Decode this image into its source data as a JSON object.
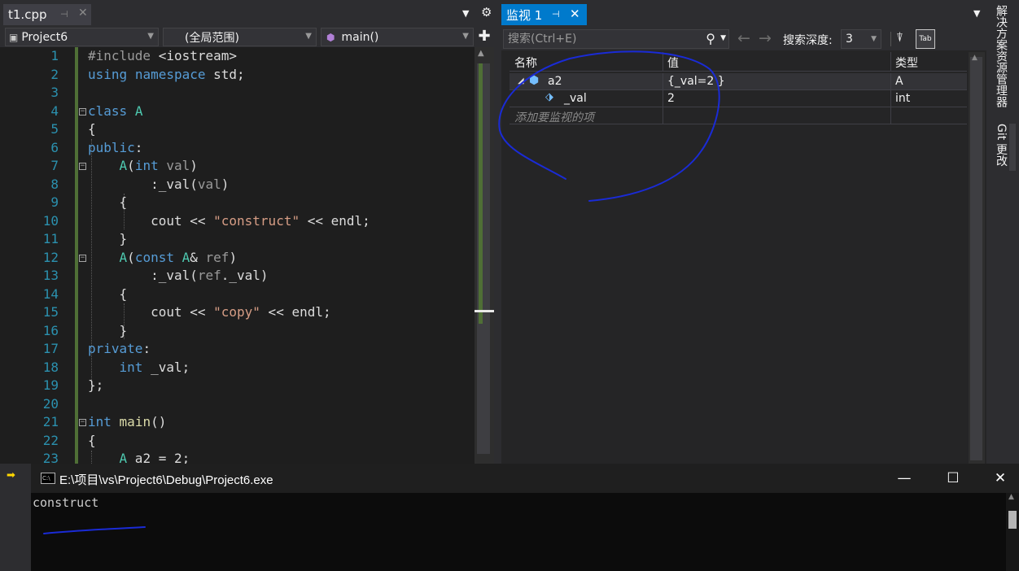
{
  "editor": {
    "tab": {
      "name": "t1.cpp",
      "pin_icon": "pin-icon",
      "close_icon": "close-icon"
    },
    "nav": {
      "project": "Project6",
      "scope": "(全局范围)",
      "member": "main()"
    },
    "code_lines": [
      {
        "n": "1",
        "text": "#include <iostream>"
      },
      {
        "n": "2",
        "text": "using namespace std;"
      },
      {
        "n": "3",
        "text": ""
      },
      {
        "n": "4",
        "text": "class A"
      },
      {
        "n": "5",
        "text": "{"
      },
      {
        "n": "6",
        "text": "public:"
      },
      {
        "n": "7",
        "text": "    A(int val)"
      },
      {
        "n": "8",
        "text": "        :_val(val)"
      },
      {
        "n": "9",
        "text": "    {"
      },
      {
        "n": "10",
        "text": "        cout << \"construct\" << endl;"
      },
      {
        "n": "11",
        "text": "    }"
      },
      {
        "n": "12",
        "text": "    A(const A& ref)"
      },
      {
        "n": "13",
        "text": "        :_val(ref._val)"
      },
      {
        "n": "14",
        "text": "    {"
      },
      {
        "n": "15",
        "text": "        cout << \"copy\" << endl;"
      },
      {
        "n": "16",
        "text": "    }"
      },
      {
        "n": "17",
        "text": "private:"
      },
      {
        "n": "18",
        "text": "    int _val;"
      },
      {
        "n": "19",
        "text": "};"
      },
      {
        "n": "20",
        "text": ""
      },
      {
        "n": "21",
        "text": "int main()"
      },
      {
        "n": "22",
        "text": "{"
      },
      {
        "n": "23",
        "text": "    A a2 = 2;"
      }
    ]
  },
  "watch": {
    "tab": {
      "name": "监视 1"
    },
    "search": {
      "placeholder": "搜索(Ctrl+E)"
    },
    "depth_label": "搜索深度:",
    "depth_value": "3",
    "columns": {
      "name": "名称",
      "value": "值",
      "type": "类型"
    },
    "rows": [
      {
        "name": "a2",
        "value": "{_val=2 }",
        "type": "A"
      },
      {
        "name": "_val",
        "value": "2",
        "type": "int"
      }
    ],
    "add_placeholder": "添加要监视的项"
  },
  "side_tabs": {
    "solution_explorer": "解决方案资源管理器",
    "git_changes": "Git 更改"
  },
  "console": {
    "title": "E:\\项目\\vs\\Project6\\Debug\\Project6.exe",
    "icon_text": "C:\\",
    "output": "construct"
  },
  "colors": {
    "accent": "#007acc",
    "annotation_ink": "#1a2bd6",
    "line_number": "#2b91af",
    "keyword": "#569cd6",
    "string": "#d69d85",
    "type": "#4ec9b0"
  }
}
